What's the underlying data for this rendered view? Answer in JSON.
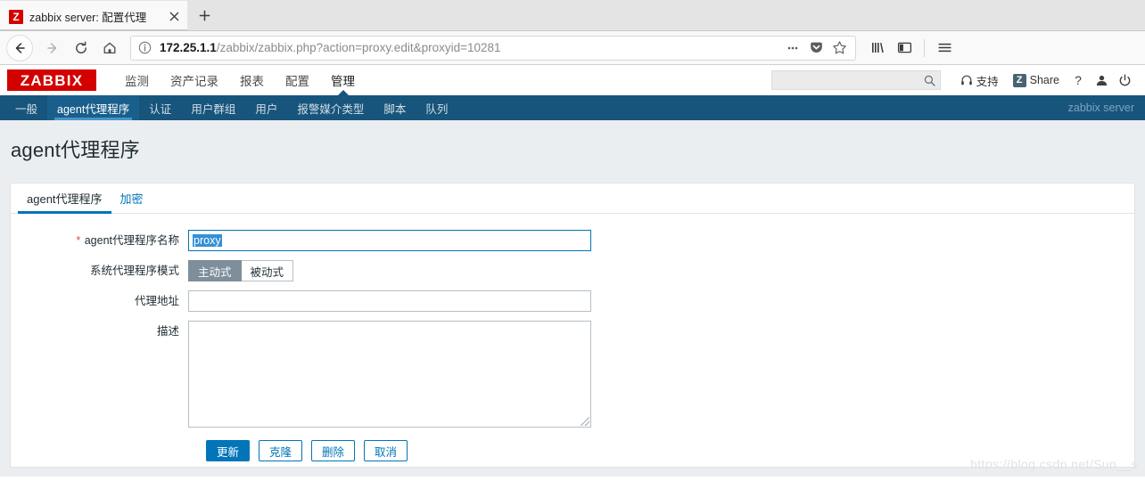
{
  "browser": {
    "tab": {
      "title": "zabbix server: 配置代理",
      "favicon_letter": "Z",
      "close_icon": "close-icon"
    },
    "newtab_label": "+",
    "nav": {
      "back": "back-icon",
      "forward": "forward-icon",
      "reload": "reload-icon",
      "home": "home-icon"
    },
    "url": {
      "host": "172.25.1.1",
      "path": "/zabbix/zabbix.php?action=proxy.edit&proxyid=10281",
      "info_icon": "info-icon",
      "actions": [
        "page-actions-icon",
        "pocket-icon",
        "bookmark-star-icon"
      ]
    },
    "toolbar_right": [
      "library-icon",
      "sidebar-icon",
      "menu-icon"
    ]
  },
  "zabbix": {
    "logo": "ZABBIX",
    "mainnav": [
      {
        "label": "监测",
        "active": false
      },
      {
        "label": "资产记录",
        "active": false
      },
      {
        "label": "报表",
        "active": false
      },
      {
        "label": "配置",
        "active": false
      },
      {
        "label": "管理",
        "active": true
      }
    ],
    "search": {
      "value": "",
      "placeholder": ""
    },
    "header_actions": {
      "support_label": "支持",
      "share_label": "Share",
      "share_badge": "Z",
      "help_label": "?",
      "user_icon": "user-icon",
      "signout_icon": "power-icon"
    },
    "subnav": [
      {
        "label": "一般",
        "active": false
      },
      {
        "label": "agent代理程序",
        "active": true
      },
      {
        "label": "认证",
        "active": false
      },
      {
        "label": "用户群组",
        "active": false
      },
      {
        "label": "用户",
        "active": false
      },
      {
        "label": "报警媒介类型",
        "active": false
      },
      {
        "label": "脚本",
        "active": false
      },
      {
        "label": "队列",
        "active": false
      }
    ],
    "server_name": "zabbix server"
  },
  "page": {
    "title": "agent代理程序",
    "tabs": [
      {
        "label": "agent代理程序",
        "active": true
      },
      {
        "label": "加密",
        "active": false
      }
    ],
    "form": {
      "name": {
        "label": "agent代理程序名称",
        "required_marker": "*",
        "value": "proxy",
        "placeholder": "",
        "selected": true
      },
      "mode": {
        "label": "系统代理程序模式",
        "options": [
          {
            "label": "主动式",
            "selected": true
          },
          {
            "label": "被动式",
            "selected": false
          }
        ]
      },
      "address": {
        "label": "代理地址",
        "value": "",
        "placeholder": ""
      },
      "description": {
        "label": "描述",
        "value": "",
        "placeholder": ""
      }
    },
    "buttons": [
      {
        "label": "更新",
        "primary": true
      },
      {
        "label": "克隆",
        "primary": false
      },
      {
        "label": "删除",
        "primary": false
      },
      {
        "label": "取消",
        "primary": false
      }
    ],
    "watermark": "https://blog.csdn.net/Sun__s"
  },
  "colors": {
    "brand_red": "#d40000",
    "nav_dark_blue": "#17557d",
    "accent_blue": "#0275b8",
    "selection_blue": "#3390d6",
    "toggle_gray": "#7e8e9a",
    "required_red": "#d64e4e"
  }
}
